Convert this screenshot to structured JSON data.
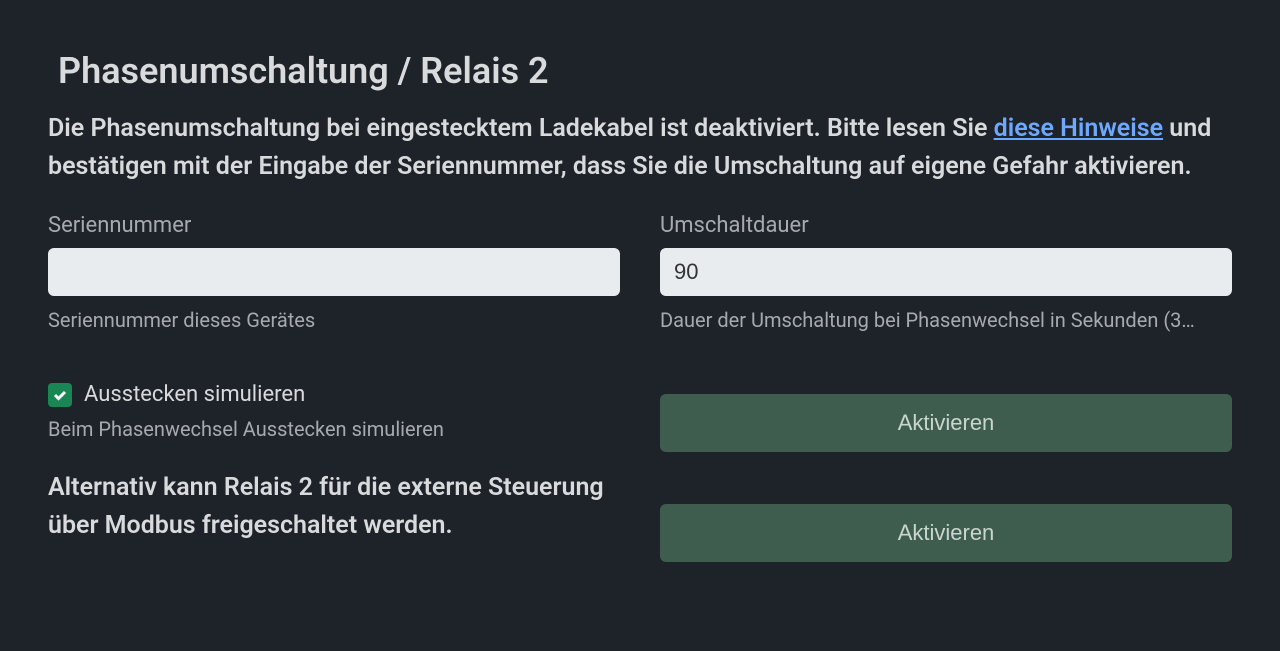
{
  "title": "Phasenumschaltung / Relais 2",
  "intro": {
    "part1": "Die Phasenumschaltung bei eingestecktem Ladekabel ist deaktiviert. Bitte lesen Sie ",
    "link": "diese Hinweise",
    "part2": " und bestätigen mit der Eingabe der Seriennummer, dass Sie die Umschaltung auf eigene Gefahr aktivieren."
  },
  "serial": {
    "label": "Seriennummer",
    "value": "",
    "help": "Seriennummer dieses Gerätes"
  },
  "duration": {
    "label": "Umschaltdauer",
    "value": "90",
    "help": "Dauer der Umschaltung bei Phasenwechsel in Sekunden (3…"
  },
  "simulate": {
    "label": "Ausstecken simulieren",
    "checked": true,
    "help": "Beim Phasenwechsel Ausstecken simulieren"
  },
  "alt_text": "Alternativ kann Relais 2 für die externe Steuerung über Modbus freigeschaltet werden.",
  "buttons": {
    "activate1": "Aktivieren",
    "activate2": "Aktivieren"
  }
}
